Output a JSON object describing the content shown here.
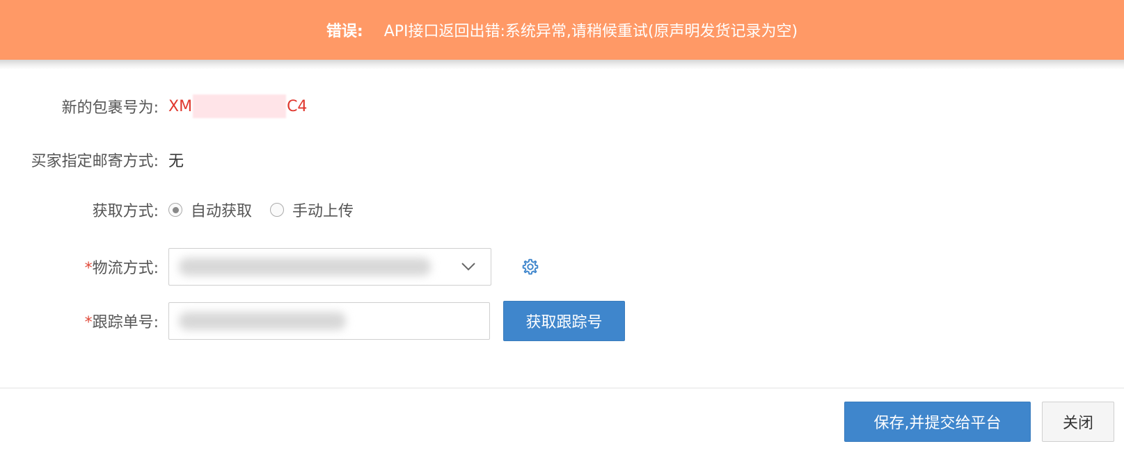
{
  "banner": {
    "label": "错误:",
    "message": "API接口返回出错:系统异常,请稍候重试(原声明发货记录为空)",
    "color": "#ff9966"
  },
  "package": {
    "label": "新的包裹号为:",
    "value_prefix": "XM",
    "value_suffix": "C4"
  },
  "buyer_shipping": {
    "label": "买家指定邮寄方式:",
    "value": "无"
  },
  "fetch_method": {
    "label": "获取方式:",
    "options": [
      {
        "label": "自动获取",
        "selected": true
      },
      {
        "label": "手动上传",
        "selected": false
      }
    ]
  },
  "logistics": {
    "required_mark": "*",
    "label": "物流方式:",
    "icon": "chevron-down-icon",
    "settings_icon": "gear-icon"
  },
  "tracking": {
    "required_mark": "*",
    "label": "跟踪单号:",
    "button_label": "获取跟踪号"
  },
  "footer": {
    "save_label": "保存,并提交给平台",
    "close_label": "关闭"
  },
  "colors": {
    "primary": "#3f86cc",
    "error_text": "#e0372e",
    "banner": "#ff9966"
  }
}
